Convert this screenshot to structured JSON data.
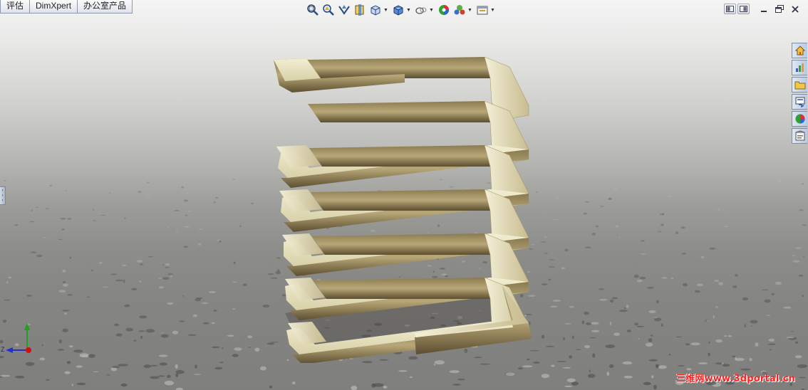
{
  "command_tabs": [
    {
      "label": "评估"
    },
    {
      "label": "DimXpert"
    },
    {
      "label": "办公室产品"
    }
  ],
  "headsup_toolbar": [
    {
      "icon": "zoom-to-fit-icon",
      "has_menu": false
    },
    {
      "icon": "zoom-to-area-icon",
      "has_menu": false
    },
    {
      "icon": "previous-view-icon",
      "has_menu": false
    },
    {
      "icon": "section-view-icon",
      "has_menu": false
    },
    {
      "icon": "view-orientation-icon",
      "has_menu": true
    },
    {
      "icon": "display-style-icon",
      "has_menu": true
    },
    {
      "icon": "hide-show-items-icon",
      "has_menu": true
    },
    {
      "icon": "edit-appearance-icon",
      "has_menu": false
    },
    {
      "icon": "apply-scene-icon",
      "has_menu": true
    },
    {
      "icon": "view-settings-icon",
      "has_menu": true
    }
  ],
  "window_controls": [
    "tile-left-icon",
    "tile-right-icon",
    "minimize-icon",
    "restore-icon",
    "close-icon"
  ],
  "task_pane": [
    {
      "icon": "solidworks-resources-icon"
    },
    {
      "icon": "design-library-icon"
    },
    {
      "icon": "file-explorer-icon"
    },
    {
      "icon": "view-palette-icon"
    },
    {
      "icon": "appearances-scenes-icon"
    },
    {
      "icon": "custom-properties-icon"
    }
  ],
  "triad": {
    "axis_z": "Z",
    "colors": {
      "x": "#d01010",
      "y": "#20a020",
      "z": "#2030d0"
    }
  },
  "watermark": "三维网www.3dportal.cn",
  "colors": {
    "spring_highlight": "#f2eed2",
    "spring_mid": "#b8a878",
    "spring_dark": "#5c4e30",
    "floor": "#858583",
    "watermark": "#ff1f1f"
  }
}
